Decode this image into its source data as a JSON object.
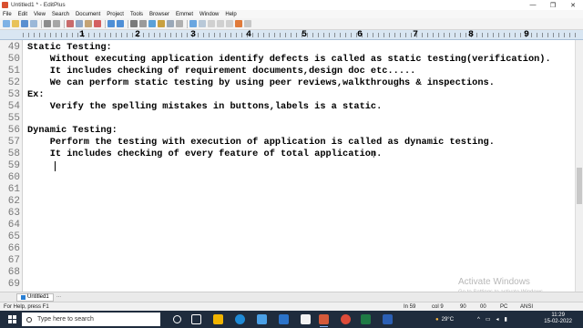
{
  "window": {
    "title": "Untitled1 * - EditPlus",
    "minimize": "—",
    "maximize": "❐",
    "close": "✕"
  },
  "menu": [
    "File",
    "Edit",
    "View",
    "Search",
    "Document",
    "Project",
    "Tools",
    "Browser",
    "Emmet",
    "Window",
    "Help"
  ],
  "ruler": {
    "numbers": [
      "1",
      "2",
      "3",
      "4",
      "5",
      "6",
      "7",
      "8",
      "9"
    ]
  },
  "editor": {
    "lines": [
      {
        "num": "49",
        "text": "Static Testing:"
      },
      {
        "num": "50",
        "text": "    Without executing application identify defects is called as static testing(verification)."
      },
      {
        "num": "51",
        "text": "    It includes checking of requirement documents,design doc etc....."
      },
      {
        "num": "52",
        "text": "    We can perform static testing by using peer reviews,walkthroughs & inspections."
      },
      {
        "num": "53",
        "text": "Ex:"
      },
      {
        "num": "54",
        "text": "    Verify the spelling mistakes in buttons,labels is a static."
      },
      {
        "num": "55",
        "text": ""
      },
      {
        "num": "56",
        "text": "Dynamic Testing:"
      },
      {
        "num": "57",
        "text": "    Perform the testing with execution of application is called as dynamic testing."
      },
      {
        "num": "58",
        "text": "    It includes checking of every feature of total application."
      },
      {
        "num": "59",
        "text": ""
      },
      {
        "num": "60",
        "text": ""
      },
      {
        "num": "61",
        "text": ""
      },
      {
        "num": "62",
        "text": ""
      },
      {
        "num": "63",
        "text": ""
      },
      {
        "num": "64",
        "text": ""
      },
      {
        "num": "65",
        "text": ""
      },
      {
        "num": "66",
        "text": ""
      },
      {
        "num": "67",
        "text": ""
      },
      {
        "num": "68",
        "text": ""
      },
      {
        "num": "69",
        "text": ""
      }
    ]
  },
  "watermark": {
    "title": "Activate Windows",
    "subtitle": "Go to Settings to activate Windows."
  },
  "tabs": [
    {
      "label": "Untitled1"
    }
  ],
  "tab_more": "...",
  "status": {
    "help": "For Help, press F1",
    "ln": "In 59",
    "col": "col 9",
    "a": "90",
    "b": "00",
    "mode": "PC",
    "encoding": "ANSI"
  },
  "taskbar": {
    "search_placeholder": "Type here to search",
    "weather": "29°C",
    "time": "11:29",
    "date": "15-02-2022"
  },
  "colors": {
    "taskbar": "#1f2c3d",
    "ruler": "#d9e6f2",
    "accent": "#2a7fd4"
  }
}
